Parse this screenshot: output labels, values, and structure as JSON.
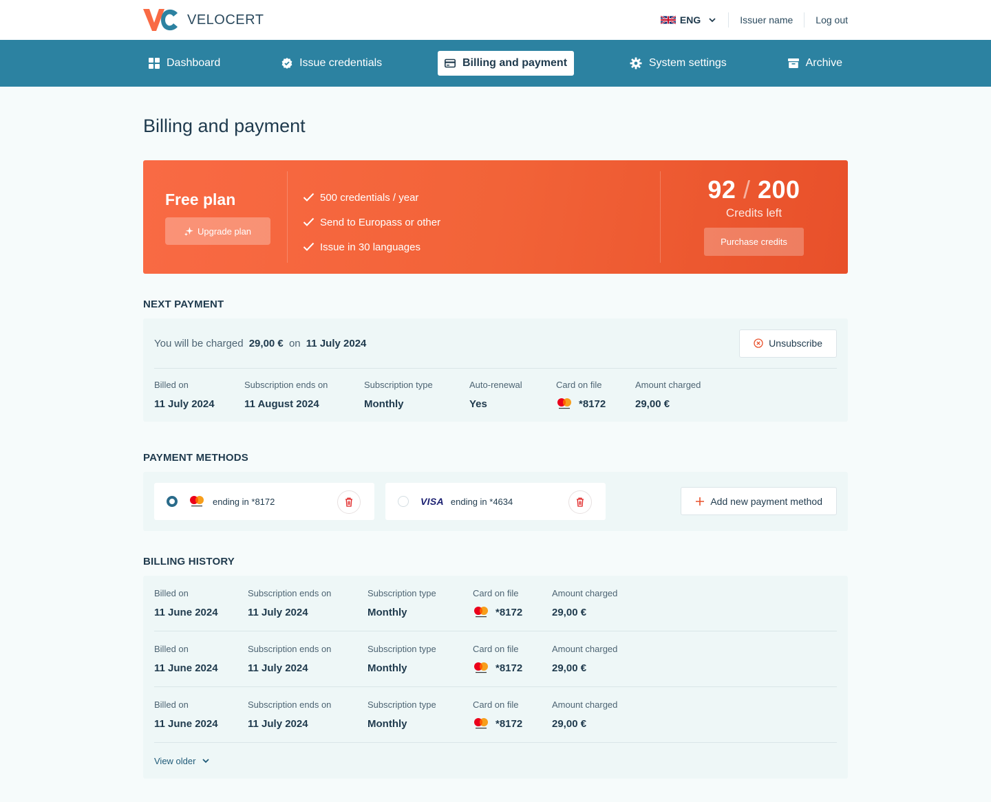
{
  "brand": {
    "name": "VELOCERT",
    "accent": "#f96a44",
    "primary": "#2c82a1"
  },
  "header": {
    "language": "ENG",
    "issuer": "Issuer name",
    "logout": "Log out"
  },
  "nav": {
    "items": [
      {
        "label": "Dashboard",
        "icon": "grid-icon"
      },
      {
        "label": "Issue credentials",
        "icon": "badge-check-icon"
      },
      {
        "label": "Billing and payment",
        "icon": "credit-card-icon",
        "active": true
      },
      {
        "label": "System settings",
        "icon": "gear-icon"
      },
      {
        "label": "Archive",
        "icon": "archive-box-icon"
      }
    ]
  },
  "page": {
    "title": "Billing and payment"
  },
  "plan": {
    "name": "Free plan",
    "upgrade_label": "Upgrade plan",
    "features": [
      "500 credentials / year",
      "Send to Europass or other",
      "Issue in 30 languages"
    ],
    "credits_used": "92",
    "credits_total": "200",
    "credits_label": "Credits left",
    "purchase_label": "Purchase credits"
  },
  "next_payment": {
    "section_title": "NEXT PAYMENT",
    "charge_prefix": "You will be charged",
    "amount": "29,00 €",
    "on": "on",
    "date": "11 July 2024",
    "unsubscribe_label": "Unsubscribe",
    "details": {
      "billed_on_label": "Billed on",
      "billed_on": "11 July 2024",
      "ends_label": "Subscription ends on",
      "ends": "11 August 2024",
      "type_label": "Subscription type",
      "type": "Monthly",
      "renewal_label": "Auto-renewal",
      "renewal": "Yes",
      "card_label": "Card on file",
      "card": "*8172",
      "amount_label": "Amount charged",
      "amount": "29,00 €"
    }
  },
  "payment_methods": {
    "section_title": "PAYMENT METHODS",
    "cards": [
      {
        "brand": "mastercard",
        "text": "ending in *8172",
        "selected": true
      },
      {
        "brand": "visa",
        "brand_text": "VISA",
        "text": "ending in *4634",
        "selected": false
      }
    ],
    "add_label": "Add new payment method"
  },
  "billing_history": {
    "section_title": "BILLING HISTORY",
    "labels": {
      "billed_on": "Billed on",
      "ends": "Subscription ends on",
      "type": "Subscription type",
      "card": "Card on file",
      "amount": "Amount charged"
    },
    "rows": [
      {
        "billed_on": "11 June 2024",
        "ends": "11 July 2024",
        "type": "Monthly",
        "card": "*8172",
        "amount": "29,00 €"
      },
      {
        "billed_on": "11 June 2024",
        "ends": "11 July 2024",
        "type": "Monthly",
        "card": "*8172",
        "amount": "29,00 €"
      },
      {
        "billed_on": "11 June 2024",
        "ends": "11 July 2024",
        "type": "Monthly",
        "card": "*8172",
        "amount": "29,00 €"
      }
    ],
    "view_older_label": "View older"
  }
}
